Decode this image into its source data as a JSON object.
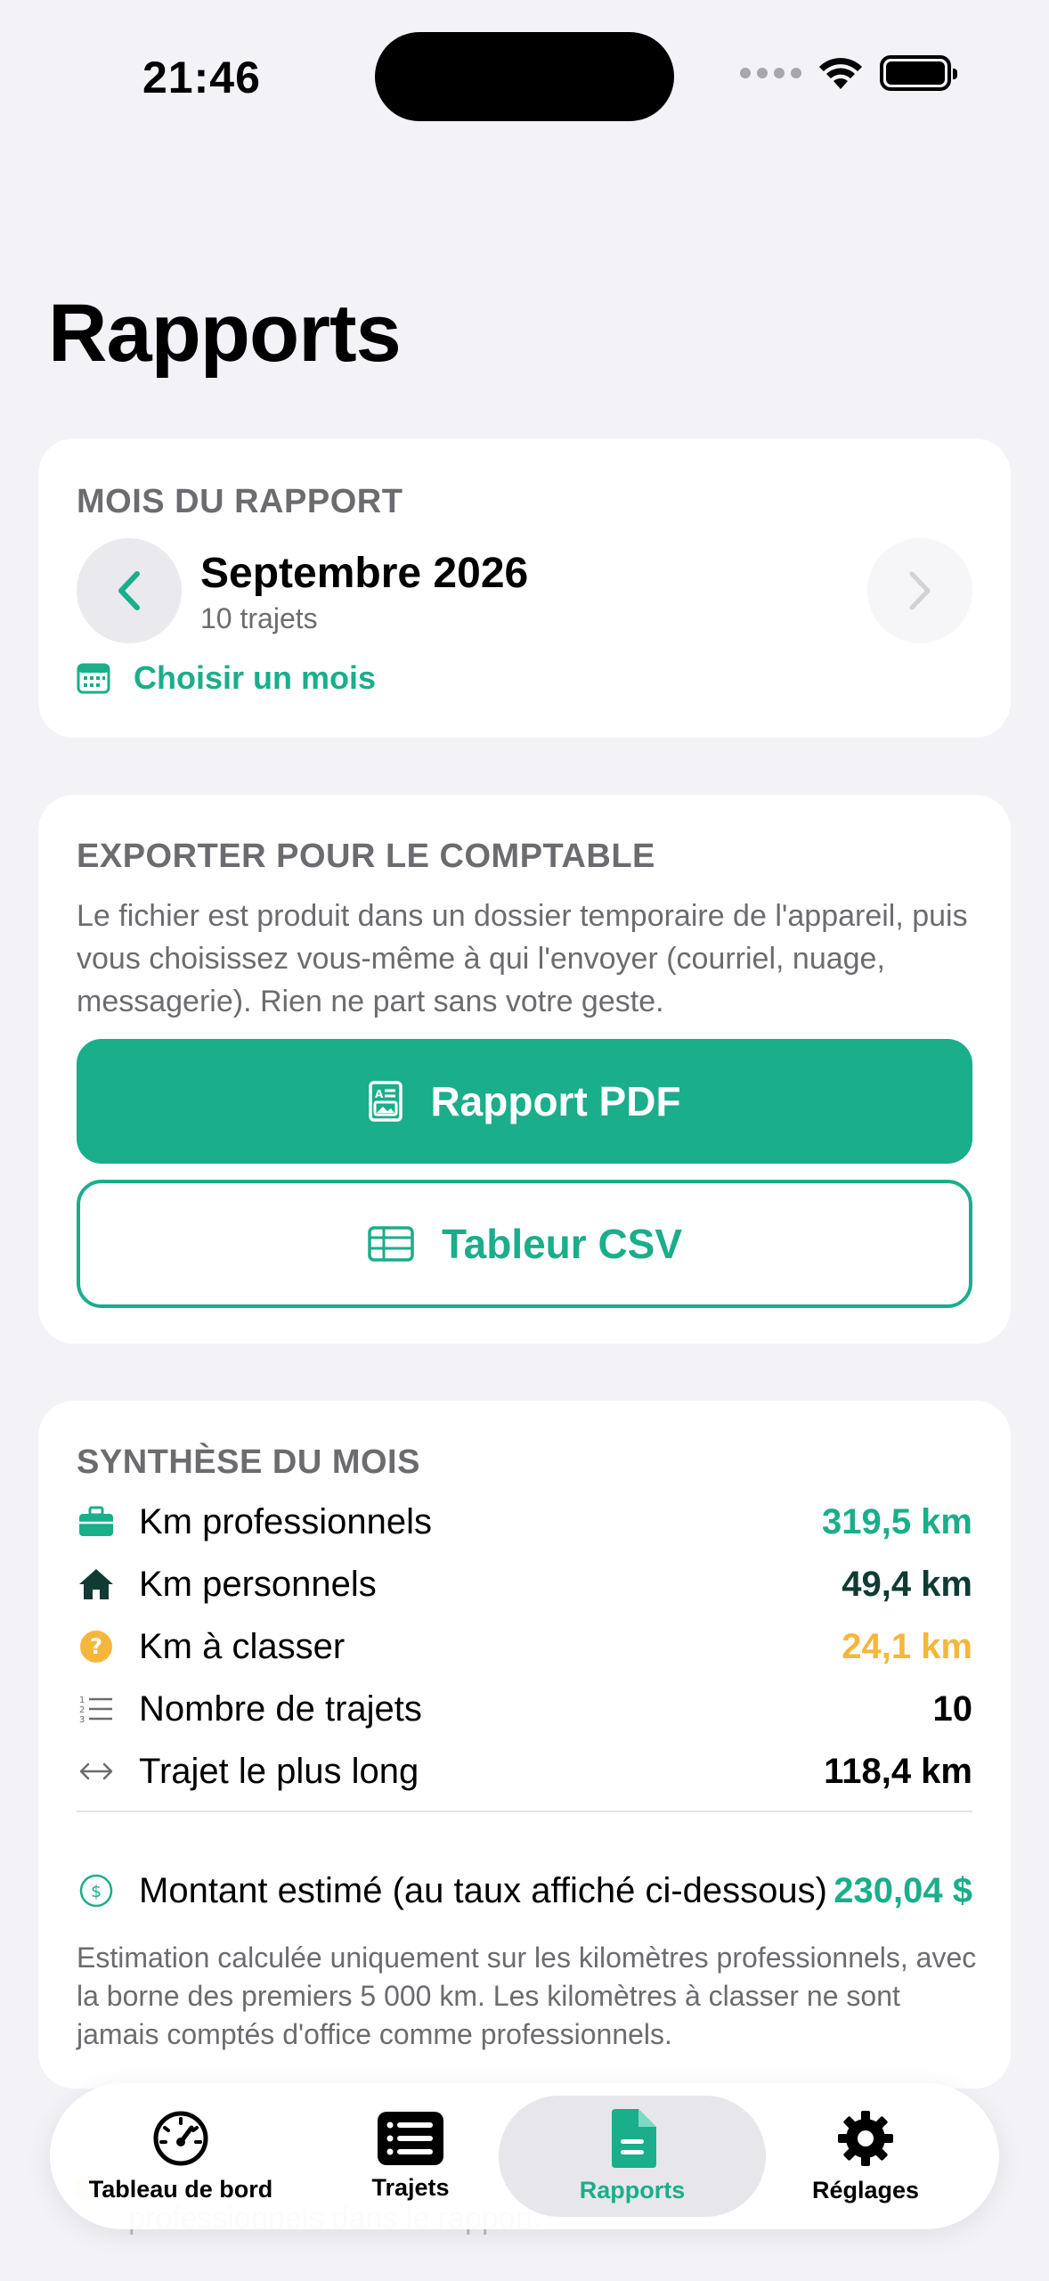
{
  "status_bar": {
    "time": "21:46"
  },
  "page": {
    "title": "Rapports"
  },
  "month_card": {
    "section_title": "MOIS DU RAPPORT",
    "month": "Septembre 2026",
    "trip_count": "10 trajets",
    "choose_label": "Choisir un mois"
  },
  "export_card": {
    "section_title": "EXPORTER POUR LE COMPTABLE",
    "description": "Le fichier est produit dans un dossier temporaire de l'appareil, puis vous choisissez vous-même à qui l'envoyer (courriel, nuage, messagerie). Rien ne part sans votre geste.",
    "pdf_label": "Rapport PDF",
    "csv_label": "Tableur CSV"
  },
  "summary_card": {
    "section_title": "SYNTHÈSE DU MOIS",
    "rows": [
      {
        "label": "Km professionnels",
        "value": "319,5 km",
        "color": "#1AAE8A",
        "icon": "briefcase-icon"
      },
      {
        "label": "Km personnels",
        "value": "49,4 km",
        "color": "#0F3B33",
        "icon": "house-icon"
      },
      {
        "label": "Km à classer",
        "value": "24,1 km",
        "color": "#F5B73B",
        "icon": "question-icon"
      },
      {
        "label": "Nombre de trajets",
        "value": "10",
        "color": "#000000",
        "icon": "numbered-list-icon"
      },
      {
        "label": "Trajet le plus long",
        "value": "118,4 km",
        "color": "#000000",
        "icon": "double-arrow-icon"
      }
    ],
    "amount_label": "Montant estimé (au taux affiché ci-dessous)",
    "amount_value": "230,04 $",
    "note": "Estimation calculée uniquement sur les kilomètres professionnels, avec la borne des premiers 5 000 km. Les kilomètres à classer ne sont jamais comptés d'office comme professionnels."
  },
  "behind_content": {
    "text": "professionnels dans le rapport."
  },
  "tab_bar": {
    "tabs": [
      {
        "label": "Tableau de bord",
        "icon": "speedometer-icon"
      },
      {
        "label": "Trajets",
        "icon": "list-icon"
      },
      {
        "label": "Rapports",
        "icon": "document-icon",
        "selected": true
      },
      {
        "label": "Réglages",
        "icon": "gear-icon"
      }
    ]
  },
  "colors": {
    "accent": "#1AAE8A",
    "warning": "#F5B73B",
    "secondary_text": "#6C6C70",
    "background": "#F2F2F7"
  }
}
